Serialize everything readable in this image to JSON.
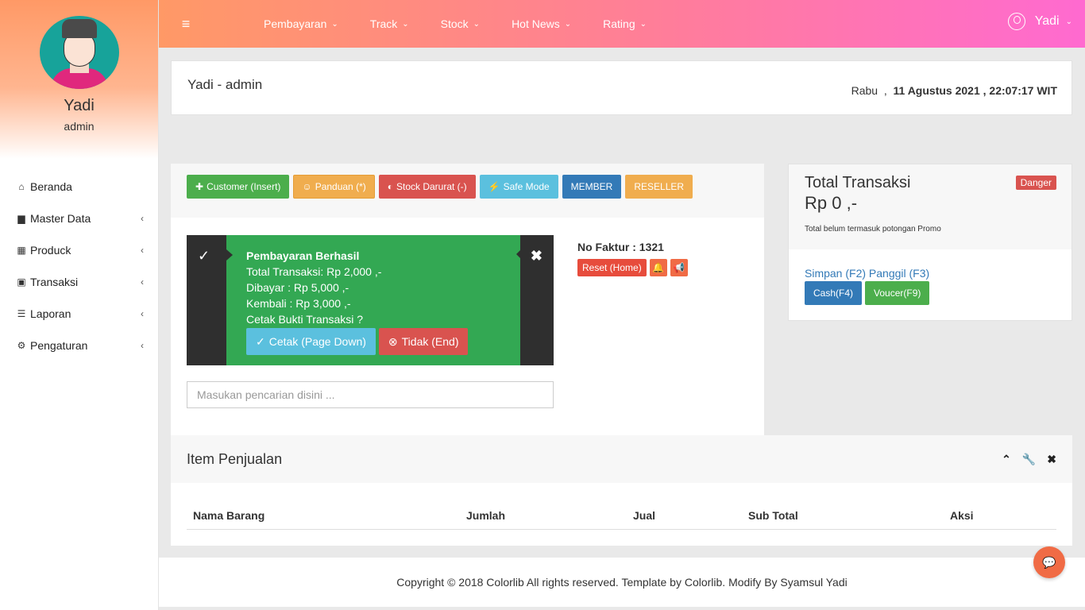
{
  "sidebar": {
    "profile": {
      "name": "Yadi",
      "role": "admin"
    },
    "items": [
      {
        "label": "Beranda",
        "icon": "home-icon",
        "glyph": "⌂"
      },
      {
        "label": "Master Data",
        "icon": "briefcase-icon",
        "glyph": "▆",
        "chevron": "‹"
      },
      {
        "label": "Produck",
        "icon": "grid-icon",
        "glyph": "▦",
        "chevron": "‹"
      },
      {
        "label": "Transaksi",
        "icon": "money-icon",
        "glyph": "▣",
        "chevron": "‹"
      },
      {
        "label": "Laporan",
        "icon": "list-icon",
        "glyph": "☰",
        "chevron": "‹"
      },
      {
        "label": "Pengaturan",
        "icon": "gear-icon",
        "glyph": "⚙",
        "chevron": "‹"
      }
    ]
  },
  "topbar": {
    "menu_glyph": "≡",
    "nav": [
      {
        "label": "Pembayaran",
        "caret": "⌄"
      },
      {
        "label": "Track",
        "caret": "⌄"
      },
      {
        "label": "Stock",
        "caret": "⌄"
      },
      {
        "label": "Hot News",
        "caret": "⌄"
      },
      {
        "label": "Rating",
        "caret": "⌄"
      }
    ],
    "user": {
      "name": "Yadi",
      "caret": "⌄"
    }
  },
  "header": {
    "title": "Yadi - admin",
    "day": "Rabu",
    "separator": ",",
    "date_time": "11 Agustus 2021 , 22:07:17 WIT"
  },
  "toolbar": {
    "buttons": [
      {
        "label": "Customer (Insert)",
        "icon": "plus-icon",
        "glyph": "✚",
        "color": "#4cae4c"
      },
      {
        "label": "Panduan (*)",
        "icon": "smile-icon",
        "glyph": "☺",
        "color": "#f0ad4e"
      },
      {
        "label": "Stock Darurat (-)",
        "icon": "half-circle-icon",
        "glyph": "◐",
        "color": "#d9534f"
      },
      {
        "label": "Safe Mode",
        "icon": "bolt-icon",
        "glyph": "⚡",
        "color": "#5bc0de"
      },
      {
        "label": "MEMBER",
        "color": "#337ab7"
      },
      {
        "label": "RESELLER",
        "color": "#f0ad4e"
      }
    ]
  },
  "notification": {
    "check_glyph": "✓",
    "close_glyph": "✖",
    "title": "Pembayaran Berhasil",
    "lines": [
      "Total Transaksi: Rp 2,000 ,-",
      "Dibayar : Rp 5,000 ,-",
      "Kembali : Rp 3,000 ,-",
      "Cetak Bukti Transaksi ?"
    ],
    "print_button": {
      "label": "Cetak (Page Down)",
      "glyph": "✓"
    },
    "cancel_button": {
      "label": "Tidak (End)",
      "glyph": "⊗"
    },
    "color": "#33a853"
  },
  "search": {
    "placeholder": "Masukan pencarian disini ...",
    "value": ""
  },
  "invoice": {
    "label": "No Faktur : 1321",
    "reset_label": "Reset (Home)",
    "bell_glyph": "🔔",
    "announce_glyph": "📢"
  },
  "summary": {
    "title": "Total Transaksi",
    "amount": "Rp 0 ,-",
    "note": "Total belum termasuk potongan Promo",
    "badge": "Danger",
    "save_link": "Simpan (F2)",
    "recall_link": "Panggil (F3)",
    "cash_button": "Cash(F4)",
    "voucher_button": "Voucer(F9)"
  },
  "items": {
    "title": "Item Penjualan",
    "tools": {
      "collapse": "⌃",
      "wrench": "🔧",
      "close": "✖"
    },
    "columns": [
      "Nama Barang",
      "Jumlah",
      "Jual",
      "Sub Total",
      "Aksi"
    ]
  },
  "footer": {
    "text": "Copyright © 2018 Colorlib All rights reserved. Template by Colorlib. Modify By Syamsul Yadi"
  },
  "chat": {
    "glyph": "💬"
  }
}
